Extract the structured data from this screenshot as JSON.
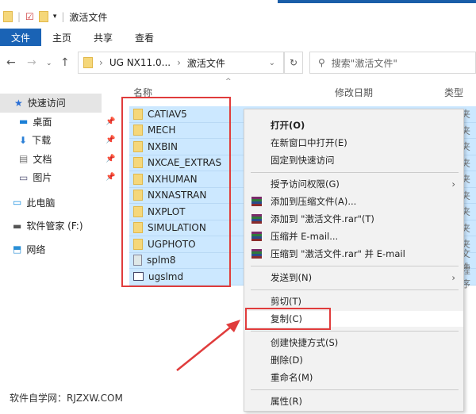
{
  "window": {
    "title": "激活文件"
  },
  "ribbon": {
    "tabs": [
      "文件",
      "主页",
      "共享",
      "查看"
    ]
  },
  "address": {
    "path": [
      "UG NX11.0...",
      "激活文件"
    ],
    "search_placeholder": "搜索\"激活文件\""
  },
  "columns": {
    "name": "名称",
    "date": "修改日期",
    "type": "类型"
  },
  "sidebar": {
    "items": [
      {
        "label": "快速访问",
        "icon": "star-icon"
      },
      {
        "label": "桌面",
        "icon": "desktop-icon",
        "pinned": true
      },
      {
        "label": "下载",
        "icon": "download-icon",
        "pinned": true
      },
      {
        "label": "文档",
        "icon": "document-icon",
        "pinned": true
      },
      {
        "label": "图片",
        "icon": "picture-icon",
        "pinned": true
      },
      {
        "label": "此电脑",
        "icon": "computer-icon"
      },
      {
        "label": "软件管家 (F:)",
        "icon": "drive-icon"
      },
      {
        "label": "网络",
        "icon": "network-icon"
      }
    ]
  },
  "files": [
    {
      "name": "CATIAV5",
      "kind": "folder",
      "type": "夹"
    },
    {
      "name": "MECH",
      "kind": "folder",
      "type": "夹"
    },
    {
      "name": "NXBIN",
      "kind": "folder",
      "type": "夹"
    },
    {
      "name": "NXCAE_EXTRAS",
      "kind": "folder",
      "type": "夹"
    },
    {
      "name": "NXHUMAN",
      "kind": "folder",
      "type": "夹"
    },
    {
      "name": "NXNASTRAN",
      "kind": "folder",
      "type": "夹"
    },
    {
      "name": "NXPLOT",
      "kind": "folder",
      "type": "夹"
    },
    {
      "name": "SIMULATION",
      "kind": "folder",
      "type": "夹"
    },
    {
      "name": "UGPHOTO",
      "kind": "folder",
      "type": "夹"
    },
    {
      "name": "splm8",
      "kind": "file",
      "type": "文件"
    },
    {
      "name": "ugslmd",
      "kind": "app",
      "type": "程序"
    }
  ],
  "context_menu": {
    "items": [
      {
        "label": "打开(O)",
        "bold": true
      },
      {
        "label": "在新窗口中打开(E)"
      },
      {
        "label": "固定到快速访问"
      },
      {
        "sep": true
      },
      {
        "label": "授予访问权限(G)",
        "submenu": true
      },
      {
        "label": "添加到压缩文件(A)...",
        "icon": "winrar-icon"
      },
      {
        "label": "添加到 \"激活文件.rar\"(T)",
        "icon": "winrar-icon"
      },
      {
        "label": "压缩并 E-mail...",
        "icon": "winrar-icon"
      },
      {
        "label": "压缩到 \"激活文件.rar\" 并 E-mail",
        "icon": "winrar-icon"
      },
      {
        "sep": true
      },
      {
        "label": "发送到(N)",
        "submenu": true
      },
      {
        "sep": true
      },
      {
        "label": "剪切(T)"
      },
      {
        "label": "复制(C)",
        "highlighted": true
      },
      {
        "sep": true
      },
      {
        "label": "创建快捷方式(S)"
      },
      {
        "label": "删除(D)"
      },
      {
        "label": "重命名(M)"
      },
      {
        "sep": true
      },
      {
        "label": "属性(R)"
      }
    ]
  },
  "watermark": "软件自学网：RJZXW.COM",
  "colors": {
    "accent": "#1a63b5",
    "selection": "#cce8ff",
    "annotation": "#e03c3c"
  }
}
